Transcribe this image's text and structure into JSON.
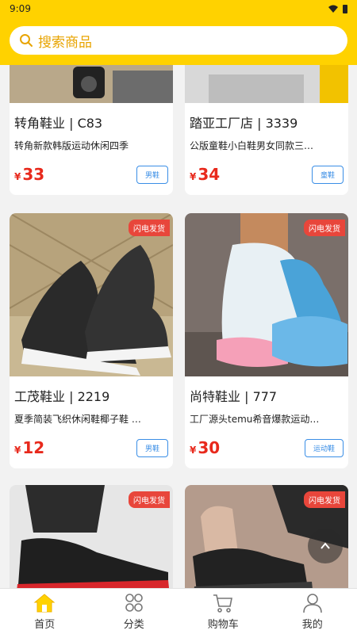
{
  "status": {
    "time": "9:09"
  },
  "search": {
    "placeholder": "搜索商品",
    "icon": "search-icon"
  },
  "colors": {
    "brand": "#ffd200",
    "price": "#e8291c",
    "tag": "#3a8ee6",
    "badge": "#e8463b"
  },
  "products": [
    {
      "title": "转角鞋业 | C83",
      "desc": "转角新款韩版运动休闲四季",
      "currency": "¥",
      "price": "33",
      "tag": "男鞋",
      "badge": ""
    },
    {
      "title": "踏亚工厂店 | 3339",
      "desc": "公版童鞋小白鞋男女同款三…",
      "currency": "¥",
      "price": "34",
      "tag": "童鞋",
      "badge": ""
    },
    {
      "title": "工茂鞋业 | 2219",
      "desc": "夏季简装飞织休闲鞋椰子鞋 …",
      "currency": "¥",
      "price": "12",
      "tag": "男鞋",
      "badge": "闪电发货"
    },
    {
      "title": "尚特鞋业 | 777",
      "desc": "工厂源头temu希音爆款运动…",
      "currency": "¥",
      "price": "30",
      "tag": "运动鞋",
      "badge": "闪电发货"
    },
    {
      "badge": "闪电发货"
    },
    {
      "badge": "闪电发货"
    }
  ],
  "tabbar": [
    {
      "label": "首页",
      "icon": "home-icon",
      "active": true
    },
    {
      "label": "分类",
      "icon": "category-icon",
      "active": false
    },
    {
      "label": "购物车",
      "icon": "cart-icon",
      "active": false
    },
    {
      "label": "我的",
      "icon": "profile-icon",
      "active": false
    }
  ]
}
